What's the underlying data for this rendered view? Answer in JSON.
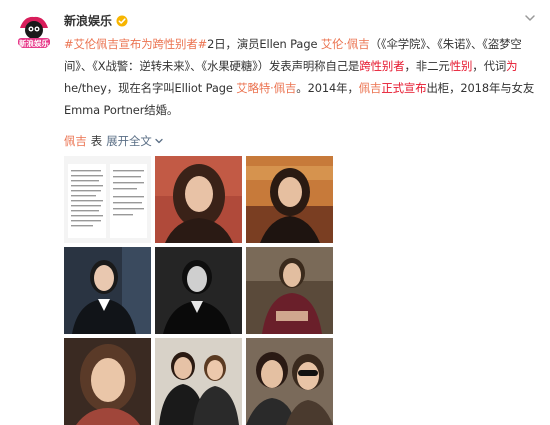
{
  "user": {
    "name": "新浪娱乐",
    "logo_text": "新浪娱乐"
  },
  "post": {
    "hashtag": "#艾伦佩吉宣布为跨性别者#",
    "text_1": "2日，演员Ellen Page ",
    "name_link": "艾伦·佩吉",
    "text_2": "（《伞学院》、《朱诺》、《盗梦空间》、《X战警：逆转未来》、《水果硬糖》）发表声明称自己是",
    "kw_trans": "跨性别者",
    "text_3": "，非二元",
    "kw_gender": "性别",
    "text_4": "，代词",
    "kw_wei": "为",
    "text_5": "he/they，现在名字叫Elliot Page ",
    "name_link_2": "艾略特·佩吉",
    "text_6": "。2014年，",
    "name_link_3": "佩吉",
    "kw_announce": "正式宣布",
    "text_7": "出柜，2018年与女友Emma Portner结婚。"
  },
  "footer": {
    "tag": "佩吉",
    "biao": "表",
    "collapse_label": "展开全文"
  },
  "colors": {
    "link": "#eb7350",
    "keyword": "#e6162d",
    "verified": "#f7b500",
    "muted": "#5b6f86"
  },
  "icons": {
    "verified": "verified-badge-icon",
    "menu": "chevron-down-icon",
    "collapse": "chevron-down-icon"
  }
}
